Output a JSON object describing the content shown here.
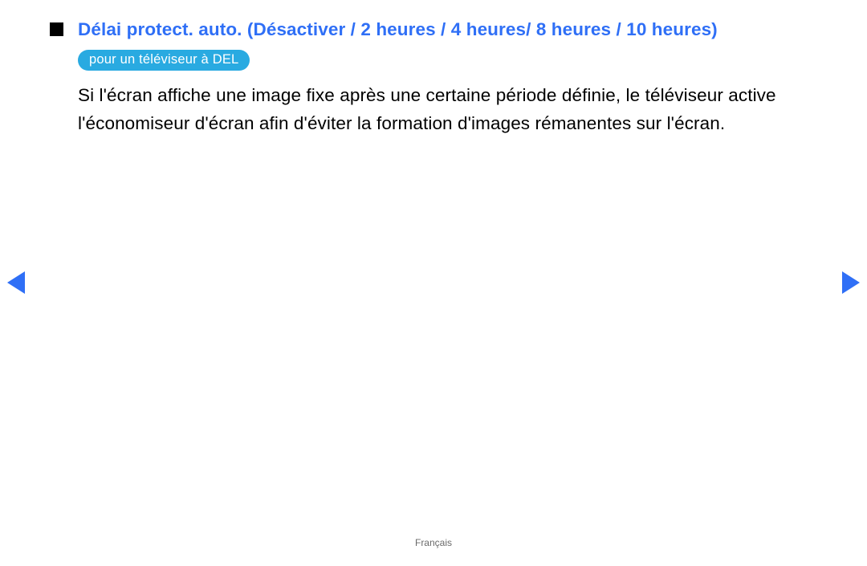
{
  "heading": "Délai protect. auto. (Désactiver / 2 heures / 4 heures/ 8 heures / 10 heures)",
  "badge": "pour un téléviseur à DEL",
  "body": "Si l'écran affiche une image fixe après une certaine période définie, le téléviseur active l'économiseur d'écran afin d'éviter la formation d'images rémanentes sur l'écran.",
  "footer": "Français"
}
